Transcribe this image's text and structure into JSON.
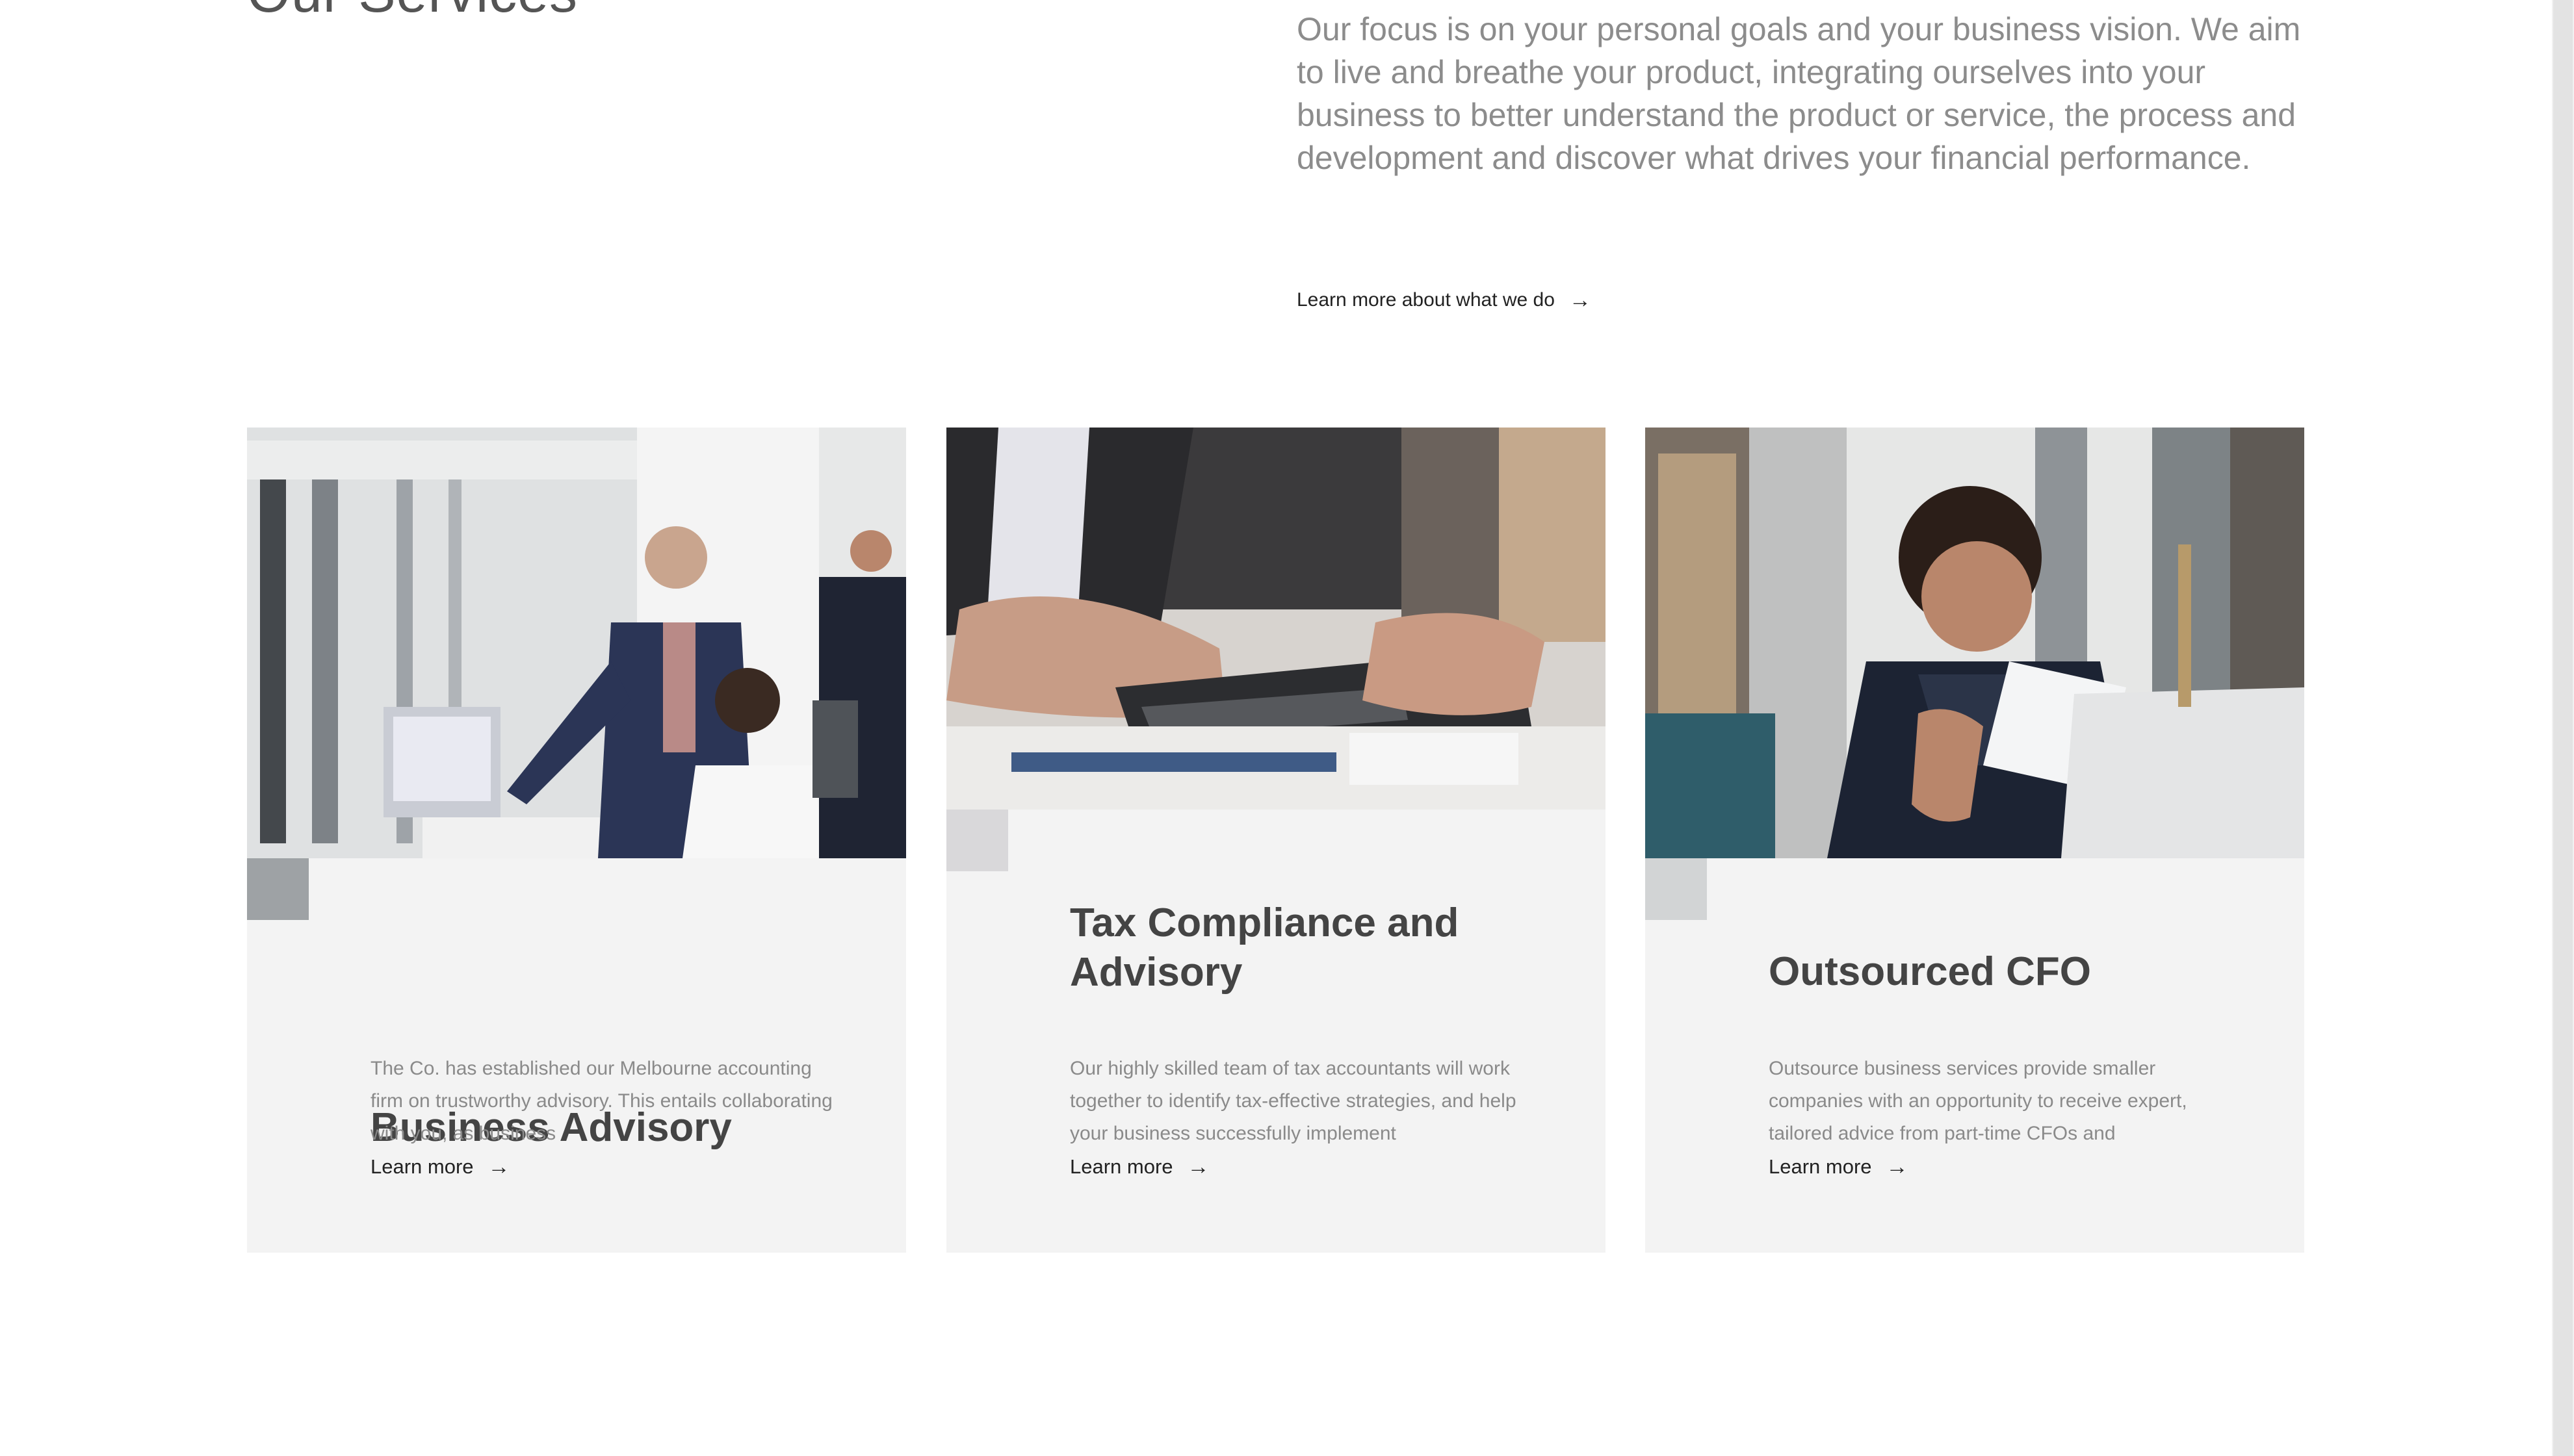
{
  "section": {
    "title": "Our Services",
    "intro": "Our focus is on your personal goals and your business vision. We aim to live and breathe your product, integrating ourselves into your business to better understand the product or service, the process and development and discover what drives your financial performance.",
    "learn_more_label": "Learn more about what we do",
    "arrow_icon": "arrow-right-icon"
  },
  "cards": [
    {
      "title": "Business Advisory",
      "text": "The Co. has established our Melbourne accounting firm on trustworthy advisory. This entails collaborating with you, as business",
      "link_label": "Learn more",
      "image": "office-meeting-photo"
    },
    {
      "title": "Tax Compliance and Advisory",
      "text": "Our highly skilled team of tax accountants will work together to identify tax-effective strategies, and help your business successfully implement",
      "link_label": "Learn more",
      "image": "calculator-hands-photo"
    },
    {
      "title": "Outsourced CFO",
      "text": "Outsource business services provide smaller companies with an opportunity to receive expert, tailored advice from part-time CFOs and",
      "link_label": "Learn more",
      "image": "woman-reading-document-photo"
    }
  ],
  "colors": {
    "card_background": "#f3f3f3",
    "body_text": "#8a8a8a",
    "heading": "#444444"
  }
}
